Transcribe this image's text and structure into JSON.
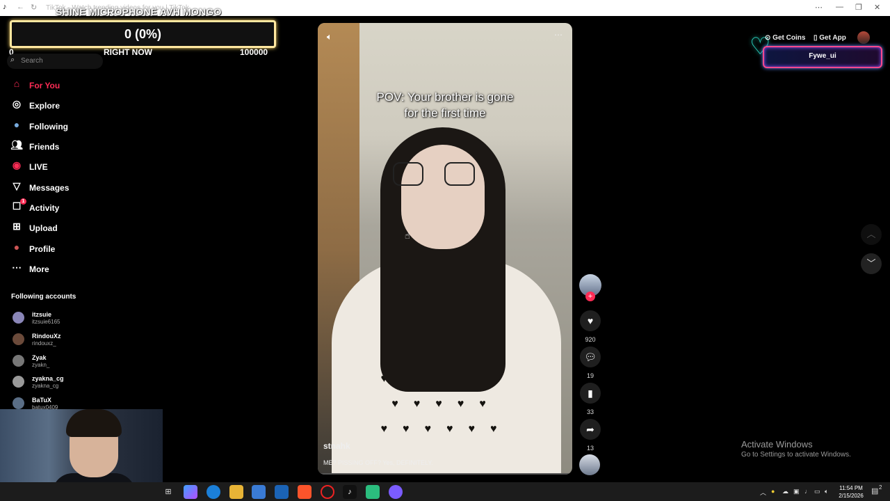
{
  "browser": {
    "title": "TikTok - Watch trending videos for you | TikTok",
    "minimize": "—",
    "restore": "❐",
    "close": "✕"
  },
  "stream_overlay": {
    "title": "SHINE MICROPHONE AVH MONGO",
    "goal_text": "0 (0%)",
    "goal_min": "0",
    "goal_label": "RIGHT NOW",
    "goal_max": "100000",
    "accent": "#ffe8a0"
  },
  "search": {
    "placeholder": "Search"
  },
  "nav": {
    "items": [
      {
        "label": "For You",
        "icon": "home-icon",
        "active": true
      },
      {
        "label": "Explore",
        "icon": "compass-icon"
      },
      {
        "label": "Following",
        "icon": "following-avatar-icon"
      },
      {
        "label": "Friends",
        "icon": "friends-icon"
      },
      {
        "label": "LIVE",
        "icon": "live-icon"
      },
      {
        "label": "Messages",
        "icon": "paper-plane-icon"
      },
      {
        "label": "Activity",
        "icon": "activity-icon",
        "badge": "1"
      },
      {
        "label": "Upload",
        "icon": "plus-square-icon"
      },
      {
        "label": "Profile",
        "icon": "profile-avatar-icon"
      },
      {
        "label": "More",
        "icon": "ellipsis-icon"
      }
    ]
  },
  "following": {
    "title": "Following accounts",
    "accounts": [
      {
        "name": "itzsuie",
        "handle": "itzsuie6165"
      },
      {
        "name": "RindouXz",
        "handle": "rindouxz_"
      },
      {
        "name": "Zyak",
        "handle": "zyakn_"
      },
      {
        "name": "zyakna_cg",
        "handle": "zyakna_cg"
      },
      {
        "name": "BaTuX",
        "handle": "batux0409"
      }
    ]
  },
  "video": {
    "caption_line1": "POV: Your brother is gone",
    "caption_line2": "for the first time",
    "creator": "stnahk",
    "description": "ME? PISSING OFF? Yes, DEFINITELY."
  },
  "actions": {
    "likes": "920",
    "comments": "19",
    "saves": "33",
    "shares": "13"
  },
  "topbar": {
    "get_coins": "Get Coins",
    "get_app": "Get App",
    "username": "Fywe_ui"
  },
  "watermark": {
    "line1": "Activate Windows",
    "line2": "Go to Settings to activate Windows."
  },
  "taskbar": {
    "time": "11:54 PM",
    "date": "2/15/2026",
    "notification_count": "2"
  },
  "colors": {
    "brand": "#fe2c55",
    "neon_border": "#ff4a8c"
  }
}
